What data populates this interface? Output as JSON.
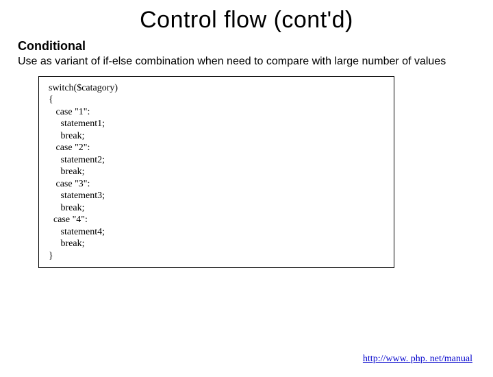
{
  "title": "Control flow (cont'd)",
  "subheading": "Conditional",
  "description": "Use as variant of if-else combination when need to compare with large number of values",
  "code": "switch($catagory)\n{\n   case \"1\":\n     statement1;\n     break;\n   case \"2\":\n     statement2;\n     break;\n   case \"3\":\n     statement3;\n     break;\n  case \"4\":\n     statement4;\n     break;\n}",
  "footer_link": "http://www. php. net/manual"
}
